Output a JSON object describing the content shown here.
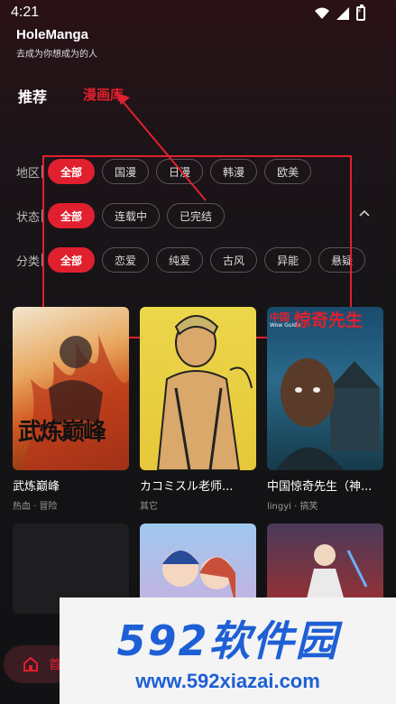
{
  "status_bar": {
    "time": "4:21"
  },
  "brand": {
    "logo_part1": "Hole",
    "logo_part2": "Manga",
    "slogan": "去成为你想成为的人"
  },
  "tabs": [
    {
      "label": "推荐"
    },
    {
      "label": "漫画库"
    }
  ],
  "filters": {
    "region": {
      "label": "地区",
      "options": [
        "全部",
        "国漫",
        "日漫",
        "韩漫",
        "欧美"
      ]
    },
    "status": {
      "label": "状态",
      "options": [
        "全部",
        "连载中",
        "已完结"
      ]
    },
    "category": {
      "label": "分类",
      "options": [
        "全部",
        "恋爱",
        "纯爱",
        "古风",
        "异能",
        "悬疑"
      ]
    }
  },
  "comics": [
    {
      "title": "武炼巅峰",
      "tags": "热血 · 冒险",
      "cover_text": "武炼巅峰"
    },
    {
      "title": "カコミスル老师...",
      "tags": "其它"
    },
    {
      "title": "中国惊奇先生（神...",
      "tags": "lingyi · 搞笑",
      "cover_text_small": "中国",
      "cover_text_big": "惊奇先生",
      "cover_text_en": "Wow Guider"
    }
  ],
  "bottom_nav": {
    "home_label": "首"
  },
  "watermark": {
    "brand": "592软件园",
    "url": "www.592xiazai.com"
  },
  "colors": {
    "accent": "#e0202e",
    "watermark_blue": "#1e5fd6"
  }
}
